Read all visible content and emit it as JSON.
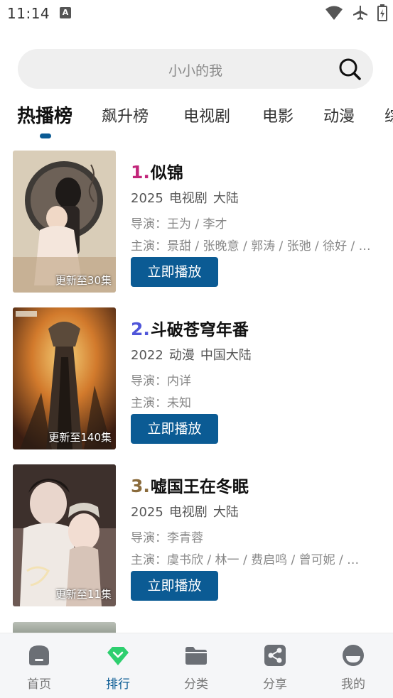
{
  "status_bar": {
    "time": "11:14",
    "notification_badge": "A"
  },
  "search": {
    "placeholder": "小小的我"
  },
  "tabs": [
    {
      "label": "热播榜",
      "active": true
    },
    {
      "label": "飙升榜"
    },
    {
      "label": "电视剧"
    },
    {
      "label": "电影"
    },
    {
      "label": "动漫"
    },
    {
      "label": "综"
    }
  ],
  "items": [
    {
      "rank": "1.",
      "rank_color": "#c2257a",
      "title": "似锦",
      "year": "2025",
      "type": "电视剧",
      "region": "大陆",
      "director": "导演：王为 / 李才",
      "actors": "主演：景甜 / 张晚意 / 郭涛 / 张弛 / 徐好 / …",
      "badge": "更新至30集",
      "button": "立即播放"
    },
    {
      "rank": "2.",
      "rank_color": "#4f55d9",
      "title": "斗破苍穹年番",
      "year": "2022",
      "type": "动漫",
      "region": "中国大陆",
      "director": "导演：内详",
      "actors": "主演：未知",
      "badge": "更新至140集",
      "button": "立即播放"
    },
    {
      "rank": "3.",
      "rank_color": "#8a6b3c",
      "title": "嘘国王在冬眠",
      "year": "2025",
      "type": "电视剧",
      "region": "大陆",
      "director": "导演：李青蓉",
      "actors": "主演：虞书欣 / 林一 / 费启鸣 / 曾可妮 / …",
      "badge": "更新至11集",
      "button": "立即播放"
    }
  ],
  "bottom_nav": [
    {
      "label": "首页",
      "icon": "home-icon"
    },
    {
      "label": "排行",
      "icon": "ranking-icon",
      "active": true
    },
    {
      "label": "分类",
      "icon": "folder-icon"
    },
    {
      "label": "分享",
      "icon": "share-icon"
    },
    {
      "label": "我的",
      "icon": "profile-icon"
    }
  ],
  "colors": {
    "accent": "#0b5b94",
    "active_nav_icon": "#2ecf6f"
  }
}
